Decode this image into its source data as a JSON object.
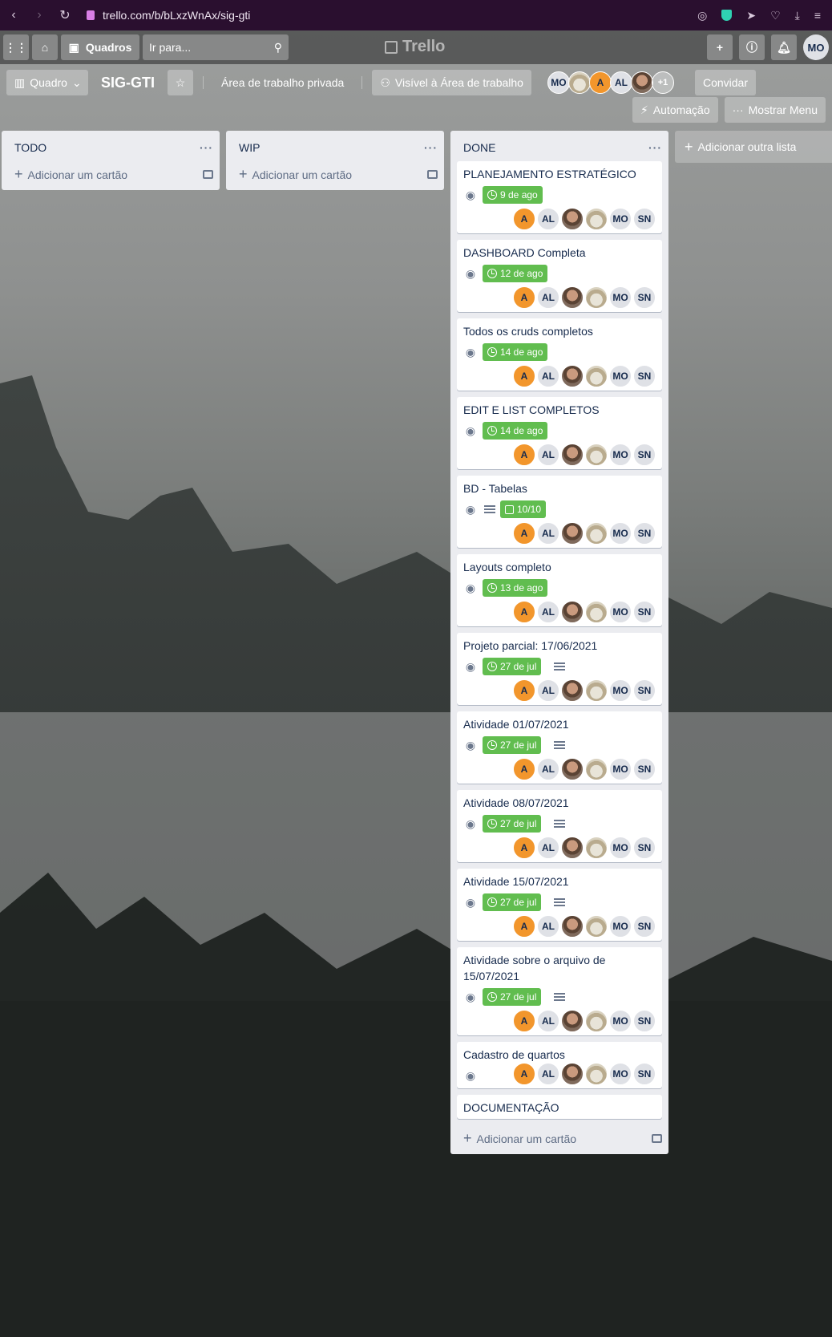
{
  "browser": {
    "url": "trello.com/b/bLxzWnAx/sig-gti"
  },
  "header": {
    "boards_label": "Quadros",
    "search_placeholder": "Ir para...",
    "logo_text": "Trello",
    "user_initials": "MO"
  },
  "board": {
    "view_label": "Quadro",
    "title": "SIG-GTI",
    "workspace_label": "Área de trabalho privada",
    "visibility_label": "Visível à Área de trabalho",
    "members": [
      "MO",
      "",
      "A",
      "AL",
      ""
    ],
    "members_extra": "+1",
    "invite_label": "Convidar",
    "automation_label": "Automação",
    "menu_label": "Mostrar Menu"
  },
  "lists": {
    "todo": {
      "title": "TODO",
      "add_label": "Adicionar um cartão"
    },
    "wip": {
      "title": "WIP",
      "add_label": "Adicionar um cartão"
    },
    "done": {
      "title": "DONE",
      "add_label": "Adicionar um cartão",
      "cards": [
        {
          "title": "PLANEJAMENTO ESTRATÉGICO",
          "badge": "9 de ago",
          "badge_type": "due",
          "desc": false
        },
        {
          "title": "DASHBOARD Completa",
          "badge": "12 de ago",
          "badge_type": "due",
          "desc": false
        },
        {
          "title": "Todos os cruds completos",
          "badge": "14 de ago",
          "badge_type": "due",
          "desc": false
        },
        {
          "title": "EDIT E LIST COMPLETOS",
          "badge": "14 de ago",
          "badge_type": "due",
          "desc": false
        },
        {
          "title": "BD - Tabelas",
          "badge": "10/10",
          "badge_type": "checklist",
          "desc": true
        },
        {
          "title": "Layouts completo",
          "badge": "13 de ago",
          "badge_type": "due",
          "desc": false
        },
        {
          "title": "Projeto parcial: 17/06/2021",
          "badge": "27 de jul",
          "badge_type": "due",
          "desc": true
        },
        {
          "title": "Atividade 01/07/2021",
          "badge": "27 de jul",
          "badge_type": "due",
          "desc": true
        },
        {
          "title": "Atividade 08/07/2021",
          "badge": "27 de jul",
          "badge_type": "due",
          "desc": true
        },
        {
          "title": "Atividade 15/07/2021",
          "badge": "27 de jul",
          "badge_type": "due",
          "desc": true
        },
        {
          "title": "Atividade sobre o arquivo de 15/07/2021",
          "badge": "27 de jul",
          "badge_type": "due",
          "desc": true
        },
        {
          "title": "Cadastro de quartos",
          "badge": "",
          "badge_type": "none",
          "desc": false
        },
        {
          "title": "DOCUMENTAÇÃO",
          "badge": "",
          "badge_type": "none",
          "desc": false,
          "no_members": true
        }
      ]
    }
  },
  "card_members": [
    "A",
    "AL",
    "",
    "",
    "MO",
    "SN"
  ],
  "add_list_label": "Adicionar outra lista",
  "colors": {
    "due_green": "#61bd4f",
    "avatar_orange": "#f2962c",
    "list_bg": "#ebecf0"
  }
}
